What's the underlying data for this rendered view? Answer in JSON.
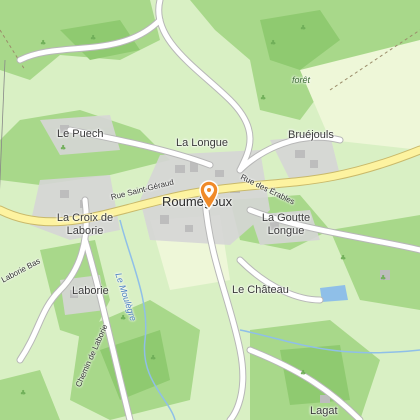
{
  "map": {
    "colors": {
      "background": "#d9f0c4",
      "forest": "#a8d88a",
      "forest_dark": "#8fca70",
      "field": "#eef7d8",
      "built": "#d6d6d6",
      "building": "#bdbdbd",
      "road_main": "#fdf3a0",
      "road_main_casing": "#c9b96a",
      "road_minor": "#ffffff",
      "road_minor_casing": "#b7b7b7",
      "water": "#8fbfe8",
      "pin": "#f08a28"
    },
    "labels": {
      "le_puech": "Le Puech",
      "la_longue": "La Longue",
      "bruejouls": "Bruéjouls",
      "foret": "forêt",
      "rue_saint_geraud": "Rue Saint-Géraud",
      "roumegoux": "Roumégoux",
      "rue_des_erables": "Rue des Érables",
      "la_croix_de_laborie": "La Croix de Laborie",
      "la_goutte_longue": "La Goutte Longue",
      "laborie_bas": "Laborie Bas",
      "le_moulegre": "Le Moulègre",
      "laborie": "Laborie",
      "le_chateau": "Le Château",
      "chemin_de_laborie": "Chemin de Laborie",
      "lagat": "Lagat"
    },
    "icons": {
      "location_pin": "map-pin-icon"
    }
  }
}
